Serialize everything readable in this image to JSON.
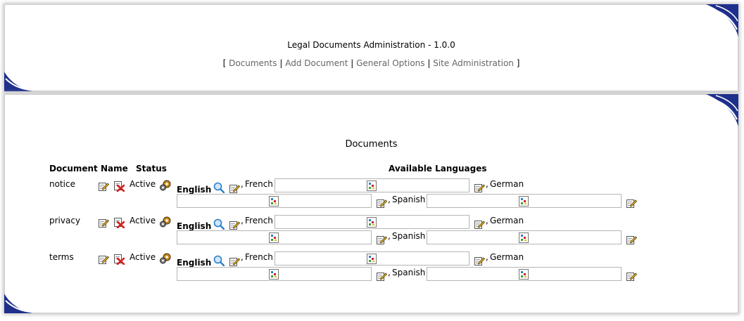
{
  "header": {
    "title": "Legal Documents Administration - 1.0.0",
    "nav": {
      "open": "[",
      "close": "]",
      "separator": "|",
      "items": [
        "Documents",
        "Add Document",
        "General Options",
        "Site Administration"
      ]
    }
  },
  "main": {
    "section_title": "Documents",
    "columns": {
      "name": "Document Name",
      "status": "Status",
      "languages": "Available Languages"
    },
    "languages": {
      "english": "English",
      "french": "French",
      "german": "German",
      "spanish": "Spanish",
      "comma": ","
    },
    "documents": [
      {
        "name": "notice",
        "status": "Active"
      },
      {
        "name": "privacy",
        "status": "Active"
      },
      {
        "name": "terms",
        "status": "Active"
      }
    ]
  },
  "colors": {
    "accent_navy": "#1f2f8c",
    "link_gray": "#666666",
    "delete_red": "#d32020",
    "search_blue": "#2a7fc7"
  }
}
